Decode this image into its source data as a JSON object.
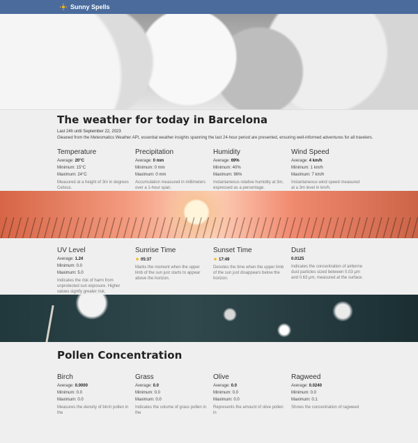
{
  "header": {
    "brand": "Sunny Spells",
    "brand_icon": "sun-icon"
  },
  "hero": {
    "image": "clouds"
  },
  "main": {
    "title": "The weather for today in Barcelona",
    "date": "Last 24h until September 22, 2023",
    "description": "Gleaned from the Meteomatics Weather API, essential weather insights spanning the last 24-hour period are presented, ensuring well-informed adventures for all travelers."
  },
  "cards1": [
    {
      "title": "Temperature",
      "average_label": "Average: ",
      "average": "20°C",
      "min": "Minimum: 15°C",
      "max": "Maximum: 24°C",
      "note": "Measured at a height of 3m in degrees Celsius."
    },
    {
      "title": "Precipitation",
      "average_label": "Average: ",
      "average": "0 mm",
      "min": "Minimum: 0 mm",
      "max": "Maximum: 0 mm",
      "note": "Accumulation measured in millimeters over a 1-hour span."
    },
    {
      "title": "Humidity",
      "average_label": "Average: ",
      "average": "69%",
      "min": "Minimum: 40%",
      "max": "Maximum: 96%",
      "note": "Instantaneous relative humidity at 3m, expressed as a percentage."
    },
    {
      "title": "Wind Speed",
      "average_label": "Average: ",
      "average": "4 km/h",
      "min": "Minimum: 1 km/h",
      "max": "Maximum: 7 km/h",
      "note": "Instantaneous wind speed measured at a 3m level in km/h."
    }
  ],
  "cards2": [
    {
      "title": "UV Level",
      "average_label": "Average: ",
      "average": "1.24",
      "min": "Minimum: 0.0",
      "max": "Maximum: 5.0",
      "note": "Indicates the risk of harm from unprotected sun exposure. Higher values signify greater risk."
    },
    {
      "title": "Sunrise Time",
      "time": "05:37",
      "icon": "sun-icon",
      "note": "Marks the moment when the upper limb of the sun just starts to appear above the horizon."
    },
    {
      "title": "Sunset Time",
      "time": "17:49",
      "icon": "sun-icon",
      "note": "Denotes the time when the upper limb of the sun just disappears below the horizon."
    },
    {
      "title": "Dust",
      "value": "0.0125",
      "note": "Indicates the concentration of airborne dust particles sized between 0.03 μm and 0.63 μm, measured at the surface."
    }
  ],
  "pollen": {
    "title": "Pollen Concentration",
    "cards": [
      {
        "title": "Birch",
        "average_label": "Average: ",
        "average": "0.0000",
        "min": "Minimum: 0.0",
        "max": "Maximum: 0.0",
        "note": "Measures the density of birch pollen in the"
      },
      {
        "title": "Grass",
        "average_label": "Average: ",
        "average": "0.0",
        "min": "Minimum: 0.0",
        "max": "Maximum: 0.0",
        "note": "Indicates the volume of grass pollen in the"
      },
      {
        "title": "Olive",
        "average_label": "Average: ",
        "average": "0.0",
        "min": "Minimum: 0.0",
        "max": "Maximum: 0.0",
        "note": "Represents the amount of olive pollen in"
      },
      {
        "title": "Ragweed",
        "average_label": "Average: ",
        "average": "0.0240",
        "min": "Minimum: 0.0",
        "max": "Maximum: 0.1",
        "note": "Shows the concentration of ragweed"
      }
    ]
  },
  "colors": {
    "topbar": "#4a6b9c",
    "background": "#efefef"
  }
}
